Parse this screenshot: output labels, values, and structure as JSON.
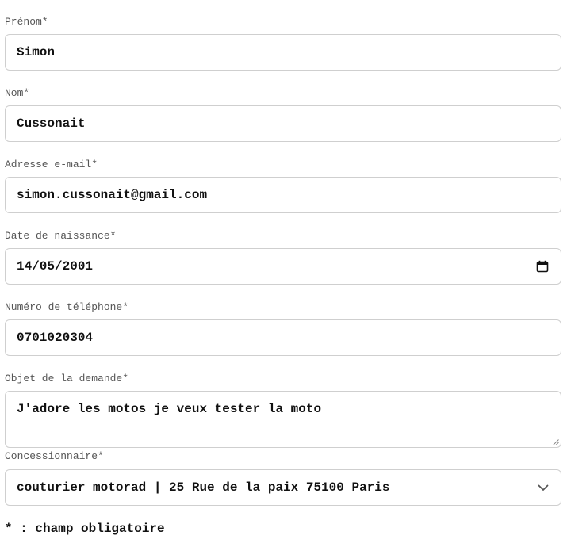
{
  "form": {
    "prenom": {
      "label": "Prénom*",
      "value": "Simon"
    },
    "nom": {
      "label": "Nom*",
      "value": "Cussonait"
    },
    "email": {
      "label": "Adresse e-mail*",
      "value": "simon.cussonait@gmail.com"
    },
    "birthdate": {
      "label": "Date de naissance*",
      "value": "14/05/2001",
      "icon": "calendar-icon"
    },
    "phone": {
      "label": "Numéro de téléphone*",
      "value": "0701020304"
    },
    "subject": {
      "label": "Objet de la demande*",
      "value": "J'adore les motos je veux tester la moto"
    },
    "dealer": {
      "label": "Concessionnaire*",
      "value": "couturier motorad | 25 Rue de la paix 75100 Paris",
      "icon": "chevron-down-icon"
    }
  },
  "footnote": "* : champ obligatoire",
  "colors": {
    "border": "#cfcfcf",
    "label": "#555555",
    "text": "#111111"
  }
}
